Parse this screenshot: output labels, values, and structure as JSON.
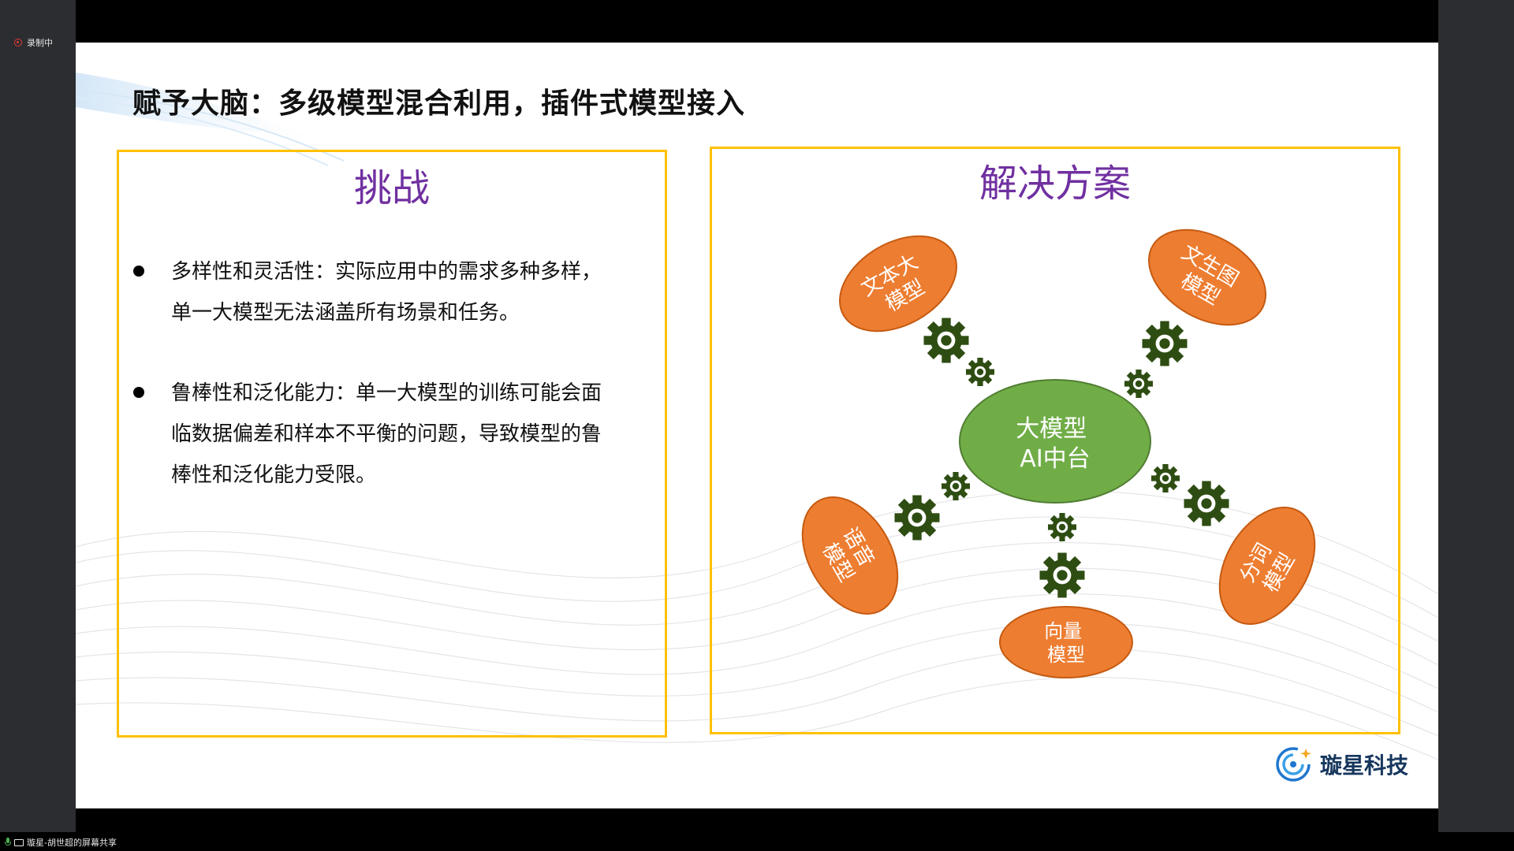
{
  "window": {
    "recording_label": "录制中",
    "share_label": "璇星-胡世超的屏幕共享"
  },
  "slide": {
    "title": "赋予大脑：多级模型混合利用，插件式模型接入",
    "challenge": {
      "heading": "挑战",
      "bullets": [
        {
          "lines": [
            "多样性和灵活性：实际应用中的需求多种多样，",
            "单一大模型无法涵盖所有场景和任务。"
          ]
        },
        {
          "lines": [
            "鲁棒性和泛化能力：单一大模型的训练可能会面",
            "临数据偏差和样本不平衡的问题，导致模型的鲁",
            "棒性和泛化能力受限。"
          ]
        }
      ]
    },
    "solution": {
      "heading": "解决方案",
      "center": {
        "lines": [
          "大模型",
          "AI中台"
        ]
      },
      "nodes": [
        {
          "id": "text-llm",
          "lines": [
            "文本大",
            "模型"
          ]
        },
        {
          "id": "text-to-image",
          "lines": [
            "文生图",
            "模型"
          ]
        },
        {
          "id": "segmentation",
          "lines": [
            "分词",
            "模型"
          ]
        },
        {
          "id": "vector",
          "lines": [
            "向量",
            "模型"
          ]
        },
        {
          "id": "speech",
          "lines": [
            "语音",
            "模型"
          ]
        }
      ]
    },
    "logo": {
      "text": "璇星科技"
    },
    "colors": {
      "title": "#111111",
      "heading": "#7030a0",
      "border": "#ffc000",
      "node_fill": "#ed7d31",
      "center_fill": "#70ad47",
      "gear": "#2e4d12",
      "logo": "#17375e"
    }
  }
}
